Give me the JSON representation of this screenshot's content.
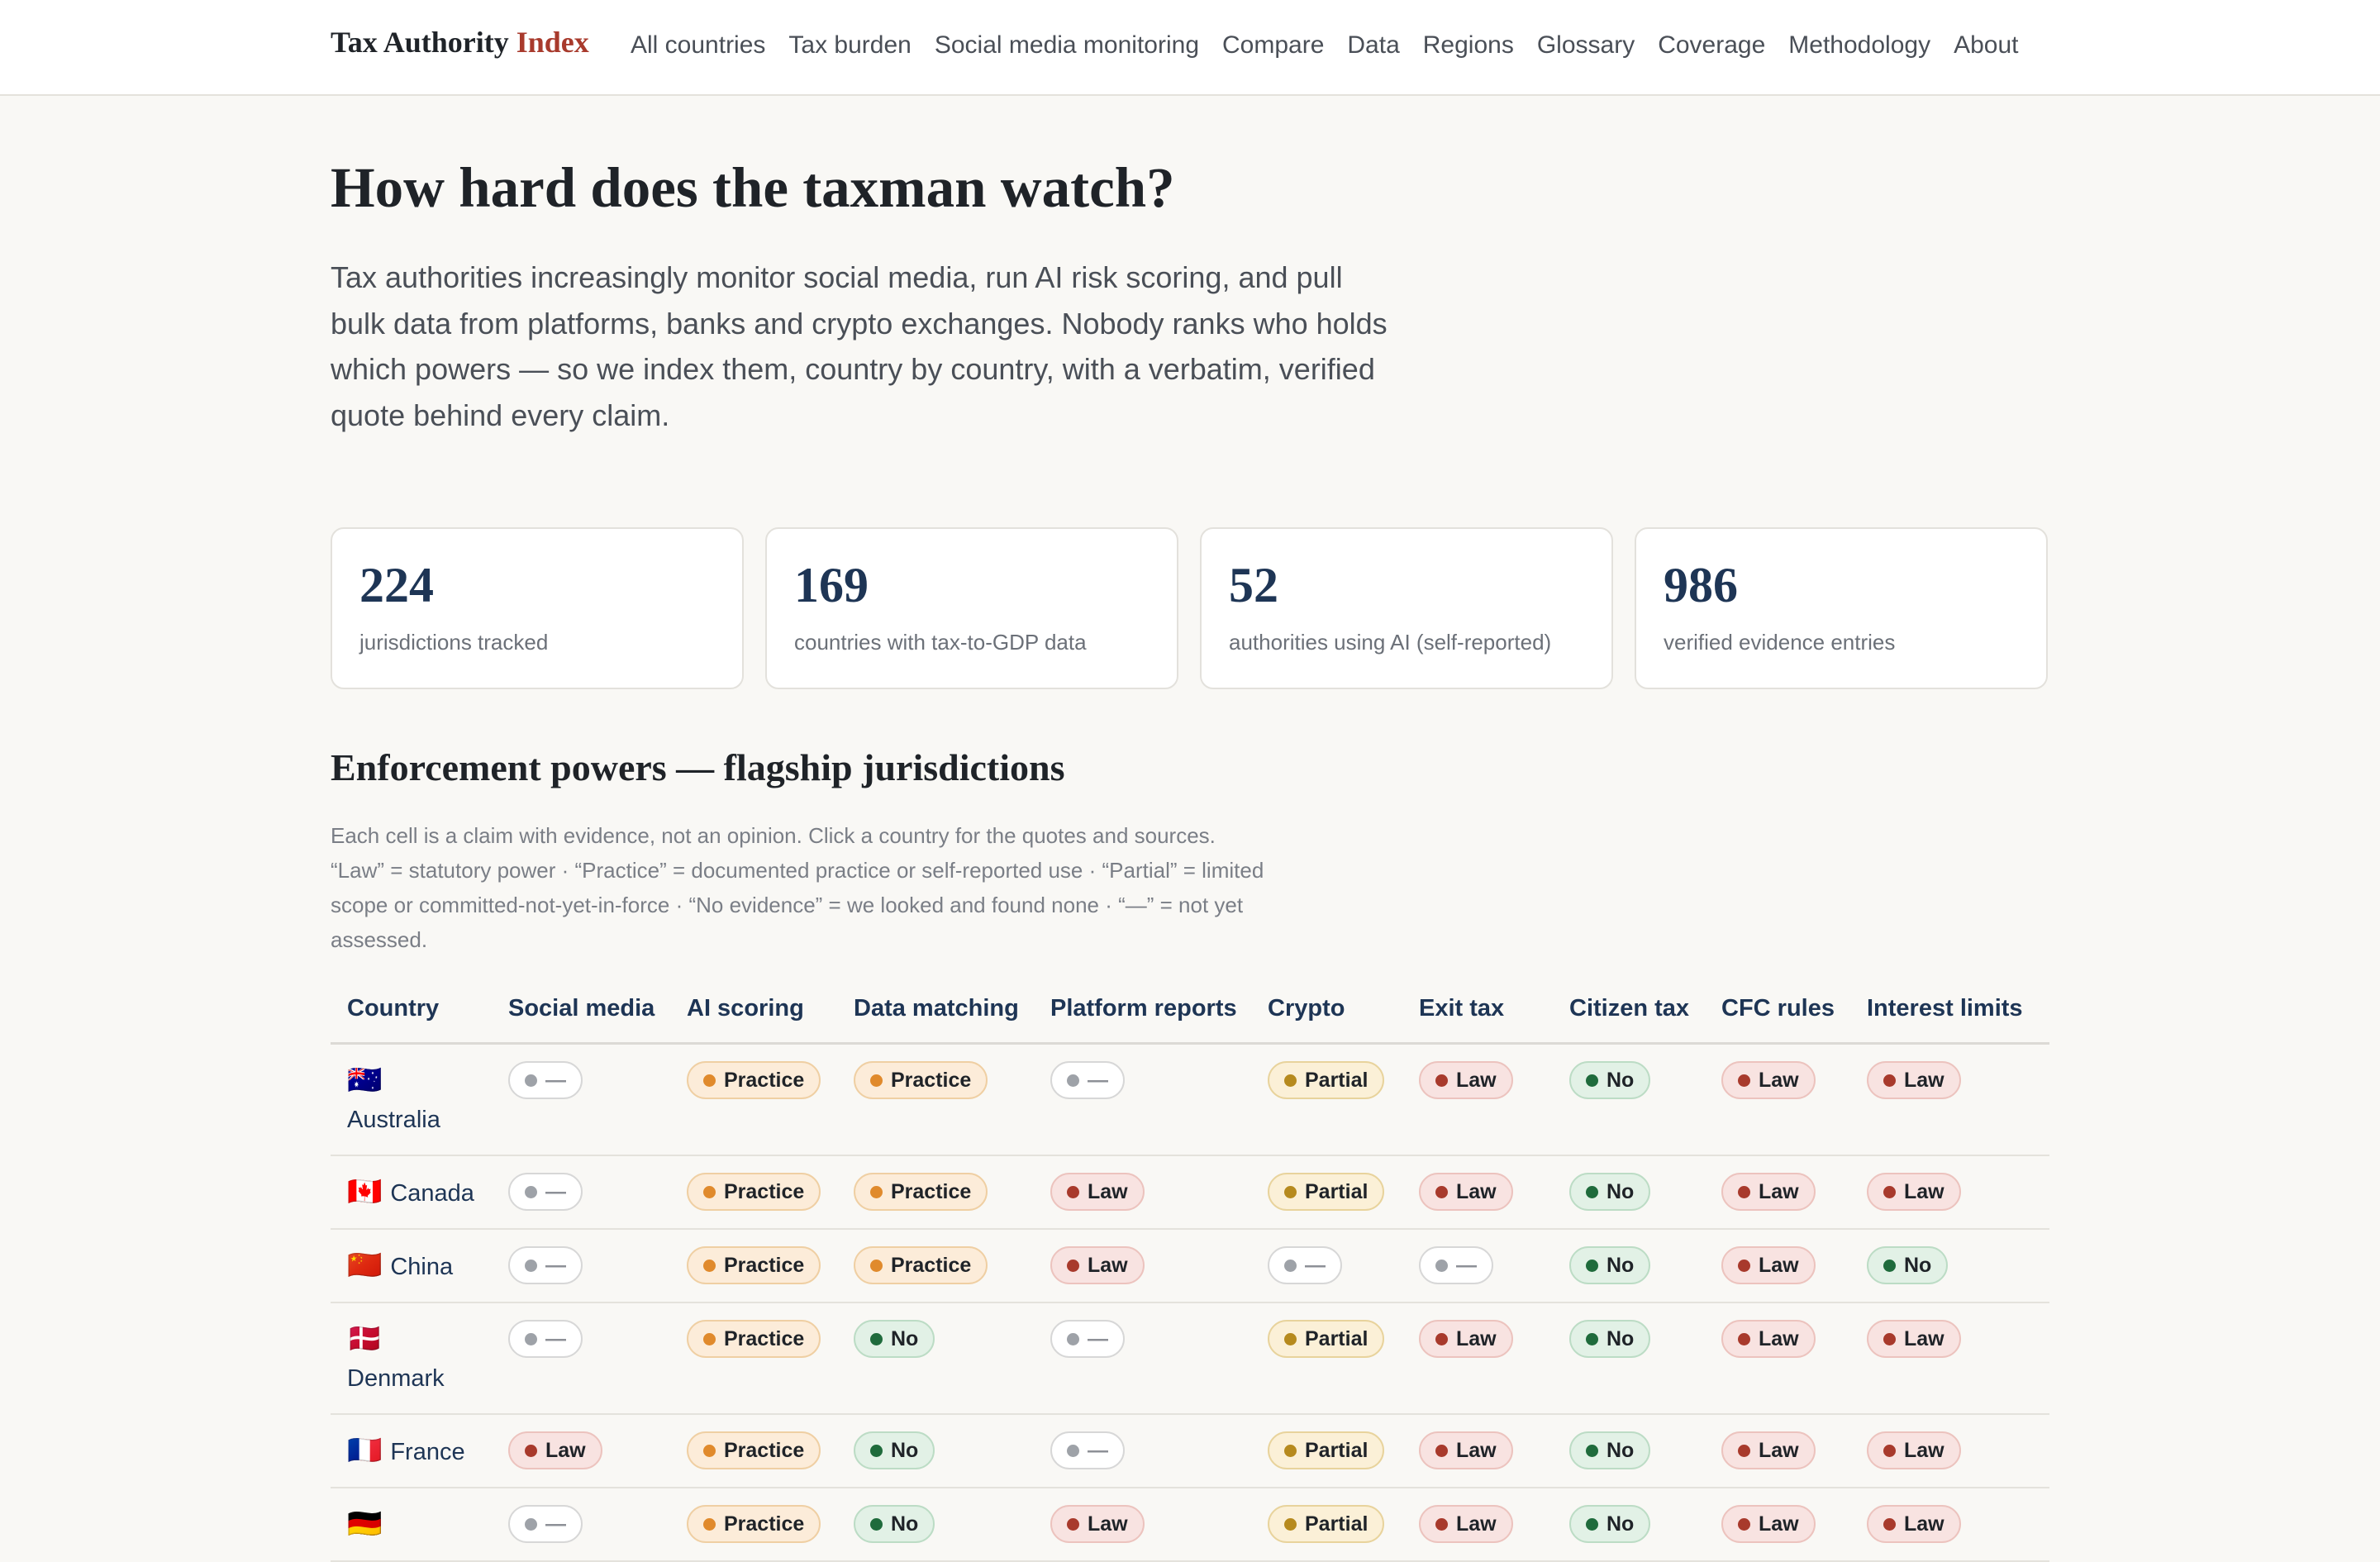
{
  "header": {
    "brand_main": "Tax Authority",
    "brand_accent": "Index",
    "nav": [
      "All countries",
      "Tax burden",
      "Social media monitoring",
      "Compare",
      "Data",
      "Regions",
      "Glossary",
      "Coverage",
      "Methodology",
      "About"
    ]
  },
  "hero": {
    "title": "How hard does the taxman watch?",
    "lead": "Tax authorities increasingly monitor social media, run AI risk scoring, and pull bulk data from platforms, banks and crypto exchanges. Nobody ranks who holds which powers — so we index them, country by country, with a verbatim, verified quote behind every claim."
  },
  "stats": [
    {
      "value": "224",
      "label": "jurisdictions tracked"
    },
    {
      "value": "169",
      "label": "countries with tax-to-GDP data"
    },
    {
      "value": "52",
      "label": "authorities using AI (self-reported)"
    },
    {
      "value": "986",
      "label": "verified evidence entries"
    }
  ],
  "section": {
    "title": "Enforcement powers — flagship jurisdictions",
    "description": "Each cell is a claim with evidence, not an opinion. Click a country for the quotes and sources. “Law” = statutory power · “Practice” = documented practice or self-reported use · “Partial” = limited scope or committed-not-yet-in-force · “No evidence” = we looked and found none · “—” = not yet assessed."
  },
  "table": {
    "columns": [
      "Country",
      "Social media",
      "AI scoring",
      "Data matching",
      "Platform reports",
      "Crypto",
      "Exit tax",
      "Citizen tax",
      "CFC rules",
      "Interest limits"
    ],
    "rows": [
      {
        "flag": "🇦🇺",
        "country": "Australia",
        "cells": [
          {
            "kind": "none",
            "label": "—"
          },
          {
            "kind": "practice",
            "label": "Practice"
          },
          {
            "kind": "practice",
            "label": "Practice"
          },
          {
            "kind": "none",
            "label": "—"
          },
          {
            "kind": "partial",
            "label": "Partial"
          },
          {
            "kind": "law",
            "label": "Law"
          },
          {
            "kind": "no",
            "label": "No"
          },
          {
            "kind": "law",
            "label": "Law"
          },
          {
            "kind": "law",
            "label": "Law"
          }
        ]
      },
      {
        "flag": "🇨🇦",
        "country": "Canada",
        "cells": [
          {
            "kind": "none",
            "label": "—"
          },
          {
            "kind": "practice",
            "label": "Practice"
          },
          {
            "kind": "practice",
            "label": "Practice"
          },
          {
            "kind": "law",
            "label": "Law"
          },
          {
            "kind": "partial",
            "label": "Partial"
          },
          {
            "kind": "law",
            "label": "Law"
          },
          {
            "kind": "no",
            "label": "No"
          },
          {
            "kind": "law",
            "label": "Law"
          },
          {
            "kind": "law",
            "label": "Law"
          }
        ]
      },
      {
        "flag": "🇨🇳",
        "country": "China",
        "cells": [
          {
            "kind": "none",
            "label": "—"
          },
          {
            "kind": "practice",
            "label": "Practice"
          },
          {
            "kind": "practice",
            "label": "Practice"
          },
          {
            "kind": "law",
            "label": "Law"
          },
          {
            "kind": "none",
            "label": "—"
          },
          {
            "kind": "none",
            "label": "—"
          },
          {
            "kind": "no",
            "label": "No"
          },
          {
            "kind": "law",
            "label": "Law"
          },
          {
            "kind": "no",
            "label": "No"
          }
        ]
      },
      {
        "flag": "🇩🇰",
        "country": "Denmark",
        "cells": [
          {
            "kind": "none",
            "label": "—"
          },
          {
            "kind": "practice",
            "label": "Practice"
          },
          {
            "kind": "no",
            "label": "No"
          },
          {
            "kind": "none",
            "label": "—"
          },
          {
            "kind": "partial",
            "label": "Partial"
          },
          {
            "kind": "law",
            "label": "Law"
          },
          {
            "kind": "no",
            "label": "No"
          },
          {
            "kind": "law",
            "label": "Law"
          },
          {
            "kind": "law",
            "label": "Law"
          }
        ]
      },
      {
        "flag": "🇫🇷",
        "country": "France",
        "cells": [
          {
            "kind": "law",
            "label": "Law"
          },
          {
            "kind": "practice",
            "label": "Practice"
          },
          {
            "kind": "no",
            "label": "No"
          },
          {
            "kind": "none",
            "label": "—"
          },
          {
            "kind": "partial",
            "label": "Partial"
          },
          {
            "kind": "law",
            "label": "Law"
          },
          {
            "kind": "no",
            "label": "No"
          },
          {
            "kind": "law",
            "label": "Law"
          },
          {
            "kind": "law",
            "label": "Law"
          }
        ]
      },
      {
        "flag": "🇩🇪",
        "country": "",
        "cells": [
          {
            "kind": "none",
            "label": "—"
          },
          {
            "kind": "practice",
            "label": "Practice"
          },
          {
            "kind": "no",
            "label": "No"
          },
          {
            "kind": "law",
            "label": "Law"
          },
          {
            "kind": "partial",
            "label": "Partial"
          },
          {
            "kind": "law",
            "label": "Law"
          },
          {
            "kind": "no",
            "label": "No"
          },
          {
            "kind": "law",
            "label": "Law"
          },
          {
            "kind": "law",
            "label": "Law"
          }
        ]
      }
    ]
  }
}
